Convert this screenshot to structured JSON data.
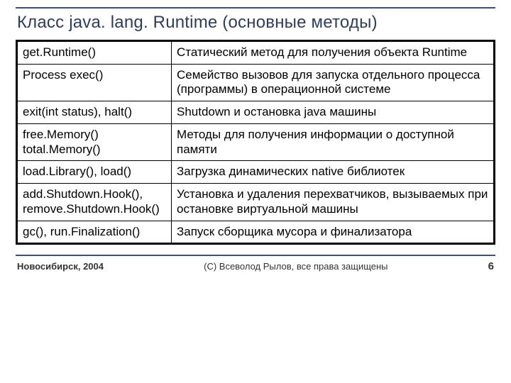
{
  "title": "Класс java. lang. Runtime (основные методы)",
  "rows": [
    {
      "method": "get.Runtime()",
      "desc": "Статический метод для получения объекта Runtime"
    },
    {
      "method": "Process exec()",
      "desc": "Семейство вызовов для запуска отдельного процесса (программы) в операционной системе"
    },
    {
      "method": "exit(int status), halt()",
      "desc": "Shutdown и остановка java машины"
    },
    {
      "method": "free.Memory()\ntotal.Memory()",
      "desc": "Методы для получения информации о доступной памяти"
    },
    {
      "method": "load.Library(), load()",
      "desc": "Загрузка динамических native библиотек"
    },
    {
      "method": "add.Shutdown.Hook(), remove.Shutdown.Hook()",
      "desc": "Установка и удаления перехватчиков, вызываемых при остановке виртуальной машины"
    },
    {
      "method": "gc(), run.Finalization()",
      "desc": "Запуск сборщика мусора и финализатора"
    }
  ],
  "footer": {
    "left": "Новосибирск, 2004",
    "center": "(С) Всеволод Рылов, все права защищены",
    "page": "6"
  }
}
